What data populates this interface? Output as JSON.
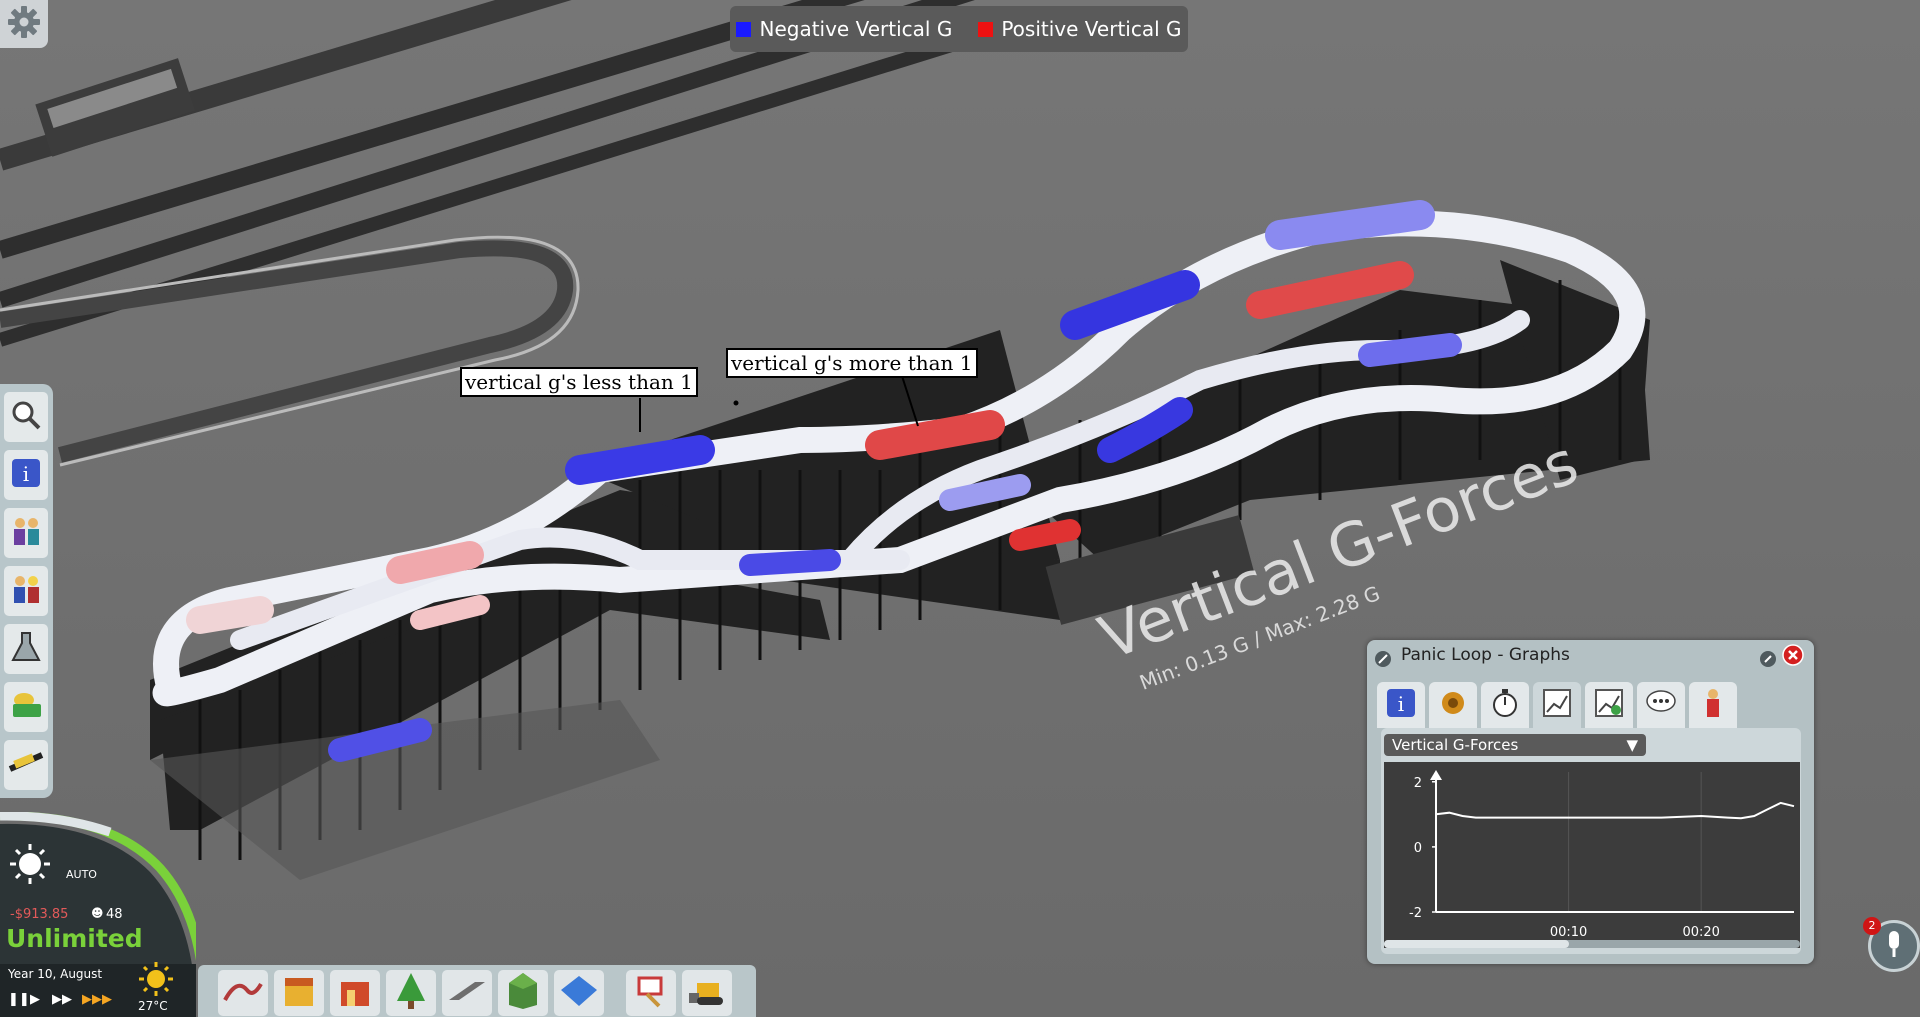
{
  "legend": {
    "items": [
      {
        "label": "Negative Vertical G",
        "color": "#1a1aff"
      },
      {
        "label": "Positive Vertical G",
        "color": "#ee1111"
      }
    ]
  },
  "annotations": {
    "less": "vertical g's less than 1",
    "more": "vertical g's more than 1"
  },
  "overlay_text": {
    "title": "Vertical G-Forces",
    "subtitle": "Min: 0.13 G / Max: 2.28 G"
  },
  "colors": {
    "negative": "#2a2ae0",
    "positive": "#e02a2a",
    "ground": "#6f6f6f",
    "track": "#f0f0f4",
    "supports": "#1e1e1e"
  },
  "left_toolbar": {
    "icons": [
      "magnifier-icon",
      "info-icon",
      "guests-icon",
      "staff-icon",
      "research-flask-icon",
      "finances-money-icon",
      "rides-coaster-icon"
    ]
  },
  "status": {
    "weather_mode": "AUTO",
    "money": "-$913.85",
    "guests": "48",
    "mode": "Unlimited",
    "date": "Year 10, August",
    "temperature": "27°C"
  },
  "bottom_bar": {
    "icons": [
      "coaster-ride-icon",
      "shops-icon",
      "buildings-icon",
      "trees-scenery-icon",
      "paths-icon",
      "terrain-icon",
      "blueprint-icon",
      "paint-icon",
      "bulldozer-icon"
    ]
  },
  "window": {
    "title": "Panic Loop - Graphs",
    "tabs": [
      "info-icon",
      "settings-gear-icon",
      "stopwatch-icon",
      "graph-icon",
      "finance-graph-icon",
      "speech-bubble-icon",
      "guest-icon"
    ],
    "dropdown_value": "Vertical G-Forces"
  },
  "chart_data": {
    "type": "line",
    "title": "",
    "xlabel": "",
    "ylabel": "",
    "x_ticks": [
      "00:10",
      "00:20"
    ],
    "y_ticks": [
      2,
      0,
      -2
    ],
    "ylim": [
      -2,
      2.3
    ],
    "x": [
      0,
      1,
      2,
      3,
      5,
      8,
      11,
      14,
      17,
      20,
      22,
      23,
      24,
      25,
      26,
      27
    ],
    "values": [
      1.0,
      1.05,
      0.95,
      0.9,
      0.9,
      0.9,
      0.9,
      0.9,
      0.9,
      0.95,
      0.9,
      0.88,
      0.95,
      1.15,
      1.35,
      1.25
    ]
  },
  "notifications": {
    "count": "2"
  }
}
